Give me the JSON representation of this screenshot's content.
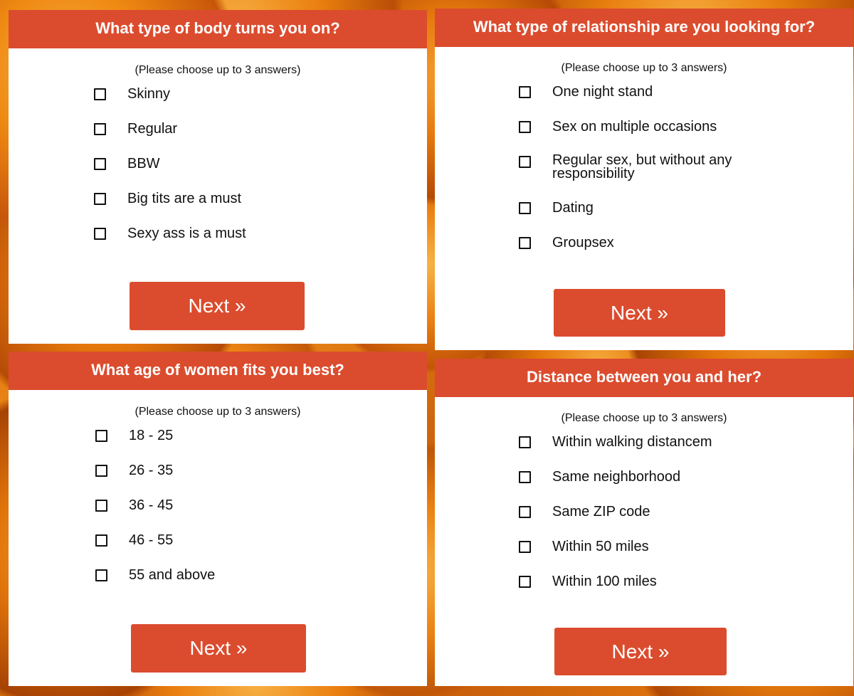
{
  "colors": {
    "accent": "#db4c2e",
    "panel_bg": "#ffffff",
    "text": "#111111"
  },
  "panels": [
    {
      "title": "What type of body turns you on?",
      "hint": "(Please choose up to 3 answers)",
      "options": [
        "Skinny",
        "Regular",
        "BBW",
        "Big tits are a must",
        "Sexy ass is a must"
      ],
      "button": "Next »"
    },
    {
      "title": "What type of relationship are you looking for?",
      "hint": "(Please choose up to 3 answers)",
      "options": [
        "One night stand",
        "Sex on multiple occasions",
        "Regular sex, but without any responsibility",
        "Dating",
        "Groupsex"
      ],
      "button": "Next »"
    },
    {
      "title": "What age of women fits you best?",
      "hint": "(Please choose up to 3 answers)",
      "options": [
        "18 - 25",
        "26 - 35",
        "36 - 45",
        "46 - 55",
        "55 and above"
      ],
      "button": "Next »"
    },
    {
      "title": "Distance between you and her?",
      "hint": "(Please choose up to 3 answers)",
      "options": [
        "Within walking distancem",
        "Same neighborhood",
        "Same ZIP code",
        "Within 50 miles",
        "Within 100 miles"
      ],
      "button": "Next »"
    }
  ]
}
